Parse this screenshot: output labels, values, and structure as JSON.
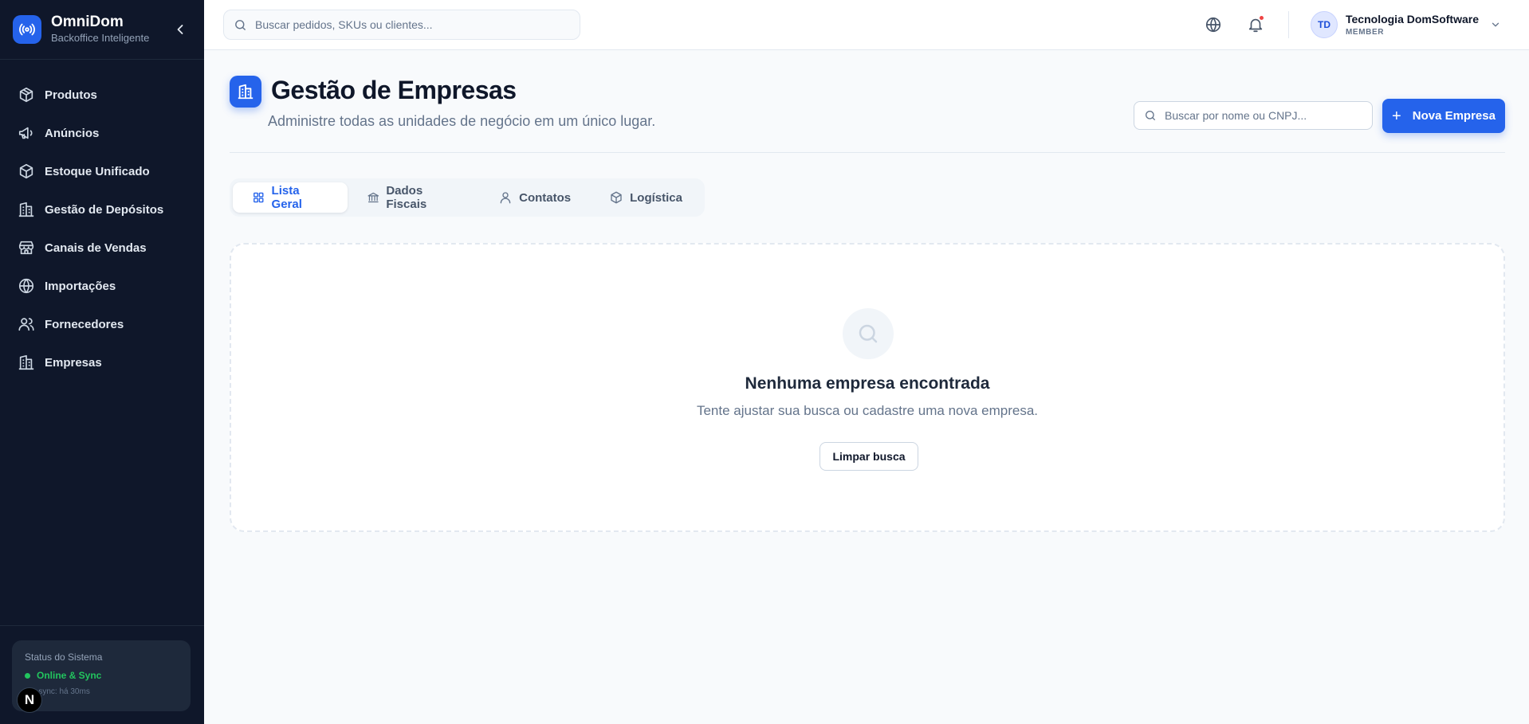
{
  "brand": {
    "name": "OmniDom",
    "subtitle": "Backoffice Inteligente"
  },
  "sidebar": {
    "items": [
      {
        "label": "Produtos",
        "icon": "package-icon"
      },
      {
        "label": "Anúncios",
        "icon": "megaphone-icon"
      },
      {
        "label": "Estoque Unificado",
        "icon": "box-icon"
      },
      {
        "label": "Gestão de Depósitos",
        "icon": "warehouse-icon"
      },
      {
        "label": "Canais de Vendas",
        "icon": "store-icon"
      },
      {
        "label": "Importações",
        "icon": "globe-icon"
      },
      {
        "label": "Fornecedores",
        "icon": "users-icon"
      },
      {
        "label": "Empresas",
        "icon": "building-icon"
      }
    ],
    "status": {
      "title": "Status do Sistema",
      "state": "Online & Sync",
      "last_sync": "a sync: há 30ms"
    },
    "dev_badge": "N"
  },
  "topbar": {
    "search_placeholder": "Buscar pedidos, SKUs ou clientes...",
    "user": {
      "initials": "TD",
      "name": "Tecnologia DomSoftware",
      "role": "MEMBER"
    }
  },
  "page": {
    "title": "Gestão de Empresas",
    "subtitle": "Administre todas as unidades de negócio em um único lugar.",
    "search_placeholder": "Buscar por nome ou CNPJ...",
    "new_button": "Nova Empresa",
    "tabs": [
      {
        "label": "Lista Geral",
        "active": true
      },
      {
        "label": "Dados Fiscais",
        "active": false
      },
      {
        "label": "Contatos",
        "active": false
      },
      {
        "label": "Logística",
        "active": false
      }
    ],
    "empty": {
      "title": "Nenhuma empresa encontrada",
      "text": "Tente ajustar sua busca ou cadastre uma nova empresa.",
      "button": "Limpar busca"
    }
  },
  "colors": {
    "accent": "#2563eb",
    "sidebar_bg": "#0f172a",
    "online": "#22c55e",
    "notification": "#ef4444"
  }
}
